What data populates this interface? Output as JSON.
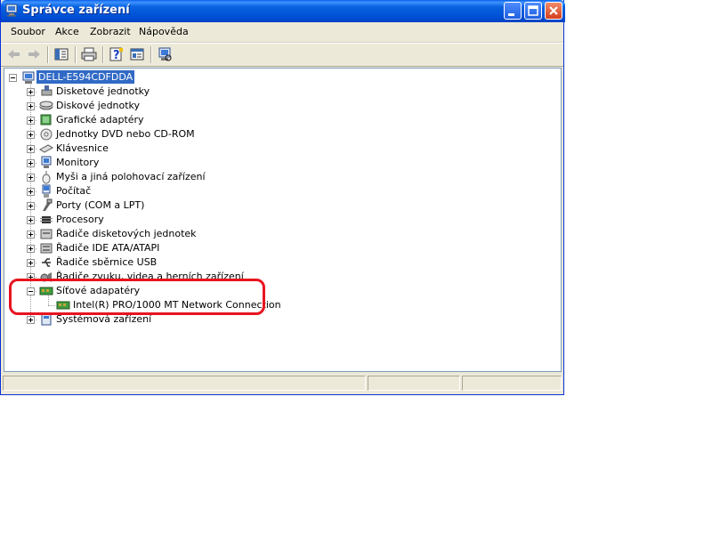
{
  "window": {
    "title": "Správce zařízení",
    "title_icon": "computer-manager-icon"
  },
  "menu": [
    "Soubor",
    "Akce",
    "Zobrazit",
    "Nápověda"
  ],
  "toolbar": {
    "icons": [
      "back-arrow-icon",
      "forward-arrow-icon",
      "show-hide-console-tree-icon",
      "print-icon",
      "help-icon",
      "properties-icon",
      "scan-hardware-icon"
    ]
  },
  "tree": {
    "root": "DELL-E594CDFDDA",
    "items": [
      {
        "label": "Disketové jednotky",
        "icon": "floppy-drive-icon"
      },
      {
        "label": "Diskové jednotky",
        "icon": "disk-drive-icon"
      },
      {
        "label": "Grafické adaptéry",
        "icon": "display-adapter-icon"
      },
      {
        "label": "Jednotky DVD nebo CD-ROM",
        "icon": "cdrom-icon"
      },
      {
        "label": "Klávesnice",
        "icon": "keyboard-icon"
      },
      {
        "label": "Monitory",
        "icon": "monitor-icon"
      },
      {
        "label": "Myši a jiná polohovací zařízení",
        "icon": "mouse-icon"
      },
      {
        "label": "Počítač",
        "icon": "computer-icon"
      },
      {
        "label": "Porty (COM a LPT)",
        "icon": "port-icon"
      },
      {
        "label": "Procesory",
        "icon": "processor-icon"
      },
      {
        "label": "Řadiče disketových jednotek",
        "icon": "floppy-controller-icon"
      },
      {
        "label": "Řadiče IDE ATA/ATAPI",
        "icon": "ide-controller-icon"
      },
      {
        "label": "Řadiče sběrnice USB",
        "icon": "usb-icon"
      },
      {
        "label": "Řadiče zvuku, videa a herních zařízení",
        "icon": "sound-icon"
      },
      {
        "label": "Síťové adapatéry",
        "icon": "network-adapter-icon",
        "expanded": true,
        "children": [
          {
            "label": "Intel(R) PRO/1000 MT Network Connection",
            "icon": "network-card-icon"
          }
        ]
      },
      {
        "label": "Systémová zařízení",
        "icon": "system-device-icon"
      }
    ]
  },
  "colors": {
    "titlebar": "#0a5fe8",
    "selection": "#316ac5",
    "highlight": "#e8141f",
    "window_bg": "#ece9d8"
  }
}
